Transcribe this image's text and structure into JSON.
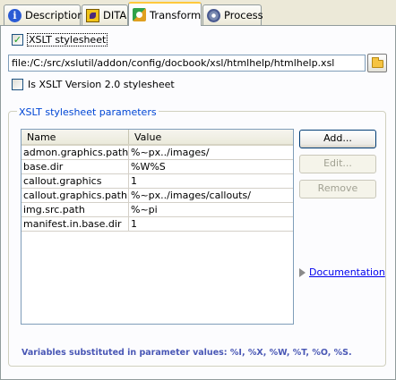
{
  "tabs": [
    {
      "label": "Description",
      "icon": "info-icon",
      "active": false
    },
    {
      "label": "DITA",
      "icon": "dita-icon",
      "active": false
    },
    {
      "label": "Transform",
      "icon": "transform-icon",
      "active": true
    },
    {
      "label": "Process",
      "icon": "process-icon",
      "active": false
    }
  ],
  "transform": {
    "xslt_stylesheet_label": "XSLT stylesheet",
    "xslt_stylesheet_checked": true,
    "stylesheet_path": "file:/C:/src/xslutil/addon/config/docbook/xsl/htmlhelp/htmlhelp.xsl",
    "xslt_v2_label": "Is XSLT Version 2.0 stylesheet",
    "xslt_v2_checked": false
  },
  "params": {
    "legend": "XSLT stylesheet parameters",
    "columns": [
      "Name",
      "Value"
    ],
    "rows": [
      {
        "name": "admon.graphics.path",
        "value": "%~px../images/"
      },
      {
        "name": "base.dir",
        "value": "%W%S"
      },
      {
        "name": "callout.graphics",
        "value": "1"
      },
      {
        "name": "callout.graphics.path",
        "value": "%~px../images/callouts/"
      },
      {
        "name": "img.src.path",
        "value": "%~pi"
      },
      {
        "name": "manifest.in.base.dir",
        "value": "1"
      }
    ],
    "add_label": "Add...",
    "edit_label": "Edit...",
    "remove_label": "Remove",
    "documentation_label": "Documentation",
    "footnote": "Variables substituted in parameter values: %I, %X, %W, %T, %O, %S."
  },
  "colors": {
    "accent": "#0046d5",
    "link": "#0000ee",
    "footnote": "#4957b5",
    "panel_bg": "#fcfcfe",
    "window_bg": "#ece9d8"
  }
}
